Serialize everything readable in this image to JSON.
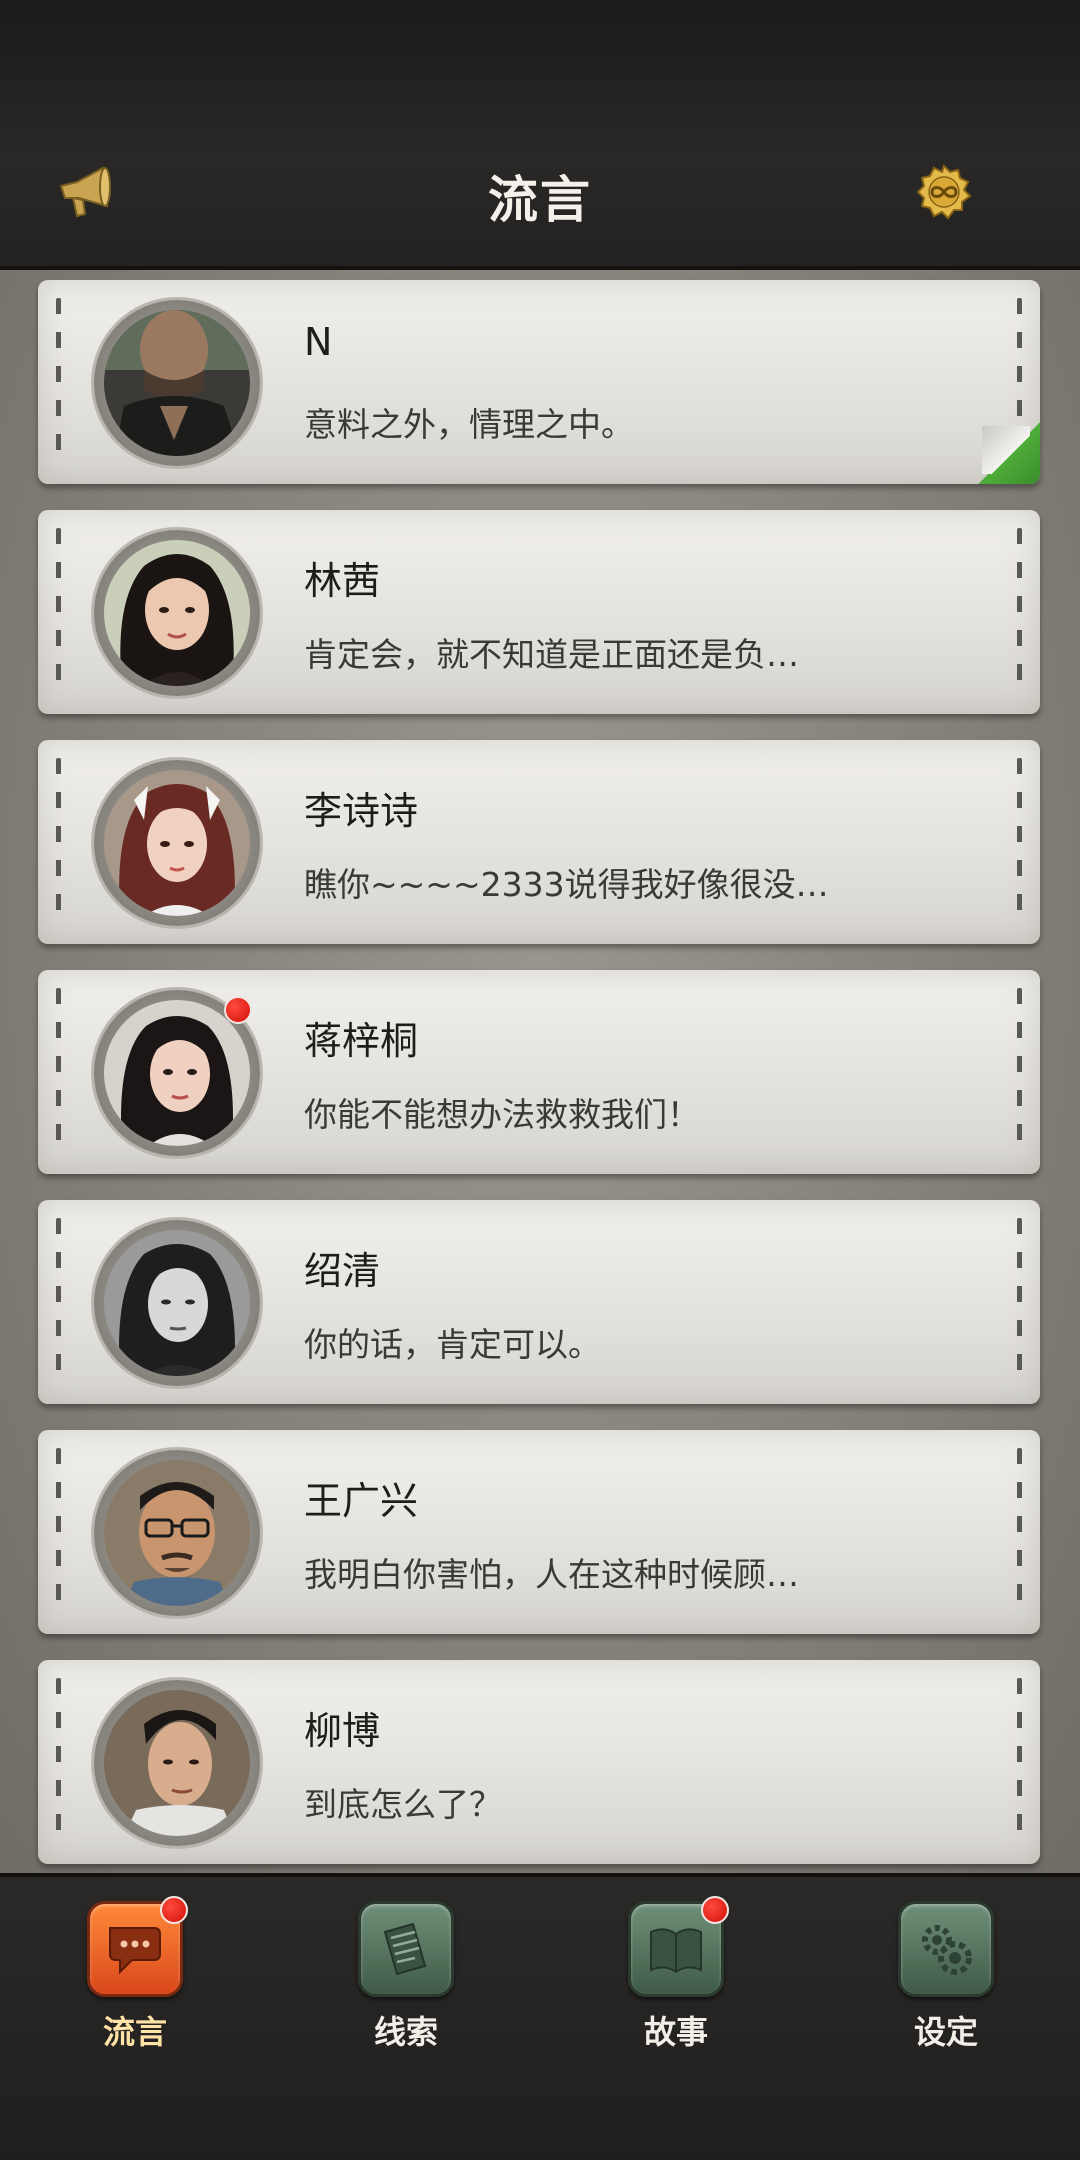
{
  "header": {
    "title": "流言",
    "left_icon": "megaphone-icon",
    "right_icon": "infinity-badge-icon"
  },
  "contacts": [
    {
      "name": "N",
      "message": "意料之外，情理之中。",
      "unread": false,
      "page_curl": true
    },
    {
      "name": "林茜",
      "message": "肯定会，就不知道是正面还是负…",
      "unread": false
    },
    {
      "name": "李诗诗",
      "message": "瞧你~~~~2333说得我好像很没…",
      "unread": false
    },
    {
      "name": "蒋梓桐",
      "message": "你能不能想办法救救我们！",
      "unread": true
    },
    {
      "name": "绍清",
      "message": "你的话，肯定可以。",
      "unread": false
    },
    {
      "name": "王广兴",
      "message": "我明白你害怕，人在这种时候顾…",
      "unread": false
    },
    {
      "name": "柳博",
      "message": "到底怎么了？",
      "unread": false
    }
  ],
  "tabs": [
    {
      "label": "流言",
      "icon": "chat-bubbles-icon",
      "active": true,
      "badge": true
    },
    {
      "label": "线索",
      "icon": "documents-icon",
      "active": false,
      "badge": false
    },
    {
      "label": "故事",
      "icon": "book-icon",
      "active": false,
      "badge": true
    },
    {
      "label": "设定",
      "icon": "gears-icon",
      "active": false,
      "badge": false
    }
  ],
  "colors": {
    "active_tab": "#e85a22",
    "inactive_tab": "#557a60",
    "badge": "#e31b10",
    "header_bg": "#242220"
  }
}
